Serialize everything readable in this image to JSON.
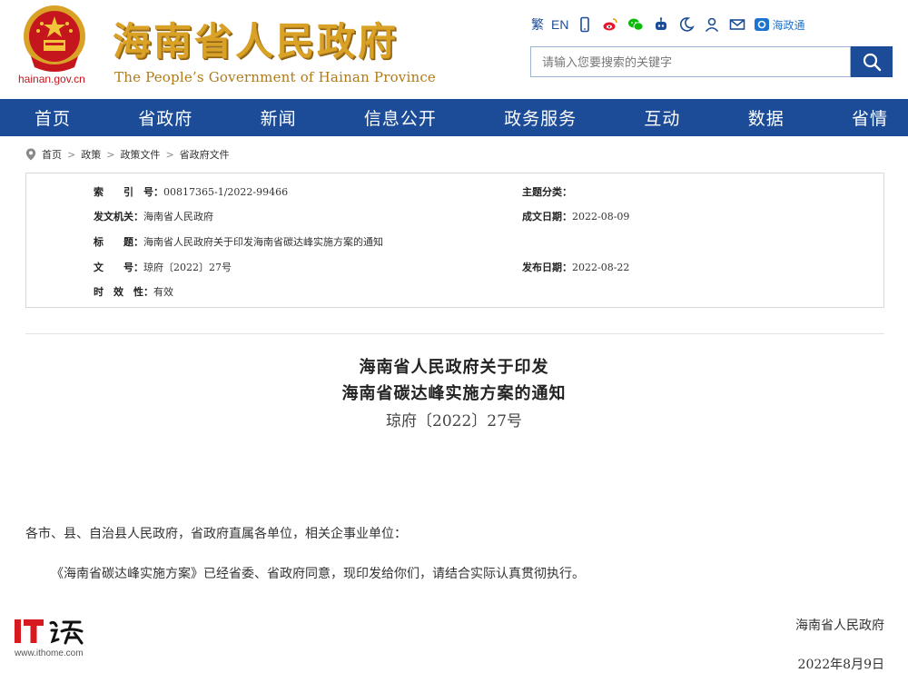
{
  "header": {
    "site_domain": "hainan.gov.cn",
    "title_cn": "海南省人民政府",
    "title_en": "The People’s Government  of Hainan Province"
  },
  "toolbar": {
    "traditional": "繁",
    "english": "EN",
    "icons": [
      "mobile-icon",
      "weibo-icon",
      "wechat-icon",
      "robot-icon",
      "night-mode-icon",
      "user-icon",
      "mail-icon"
    ],
    "brand_label": "海政通"
  },
  "search": {
    "placeholder": "请输入您要搜索的关键字"
  },
  "nav": {
    "items": [
      "首页",
      "省政府",
      "新闻",
      "信息公开",
      "政务服务",
      "互动",
      "数据",
      "省情"
    ]
  },
  "breadcrumb": {
    "items": [
      "首页",
      "政策",
      "政策文件",
      "省政府文件"
    ],
    "separator": ">"
  },
  "meta": {
    "index_label": "索　　引　号：",
    "index_value": "00817365-1/2022-99466",
    "topic_label": "主题分类：",
    "topic_value": "",
    "issuer_label": "发文机关：",
    "issuer_value": "海南省人民政府",
    "written_label": "成文日期：",
    "written_value": "2022-08-09",
    "title_label": "标　　题：",
    "title_value": "海南省人民政府关于印发海南省碳达峰实施方案的通知",
    "docno_label": "文　　号：",
    "docno_value": "琼府〔2022〕27号",
    "published_label": "发布日期：",
    "published_value": "2022-08-22",
    "validity_label": "时　效　性：",
    "validity_value": "有效"
  },
  "document": {
    "title_line1": "海南省人民政府关于印发",
    "title_line2": "海南省碳达峰实施方案的通知",
    "doc_number": "琼府〔2022〕27号",
    "salutation": "各市、县、自治县人民政府，省政府直属各单位，相关企事业单位：",
    "body": "《海南省碳达峰实施方案》已经省委、省政府同意，现印发给你们，请结合实际认真贯彻执行。",
    "signature_org": "海南省人民政府",
    "signature_date": "2022年8月9日"
  },
  "watermark": {
    "url": "www.ithome.com"
  },
  "colors": {
    "nav_blue": "#1c4c97",
    "title_gold": "#d9a227",
    "emblem_red": "#c4161c"
  }
}
